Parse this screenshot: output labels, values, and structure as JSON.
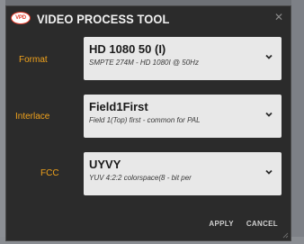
{
  "window": {
    "logo_text": "VPD",
    "title": "VIDEO PROCESS TOOL"
  },
  "rows": [
    {
      "label": "Format",
      "value": "HD 1080 50 (I)",
      "description": "SMPTE 274M - HD 1080I @ 50Hz"
    },
    {
      "label": "Interlace",
      "value": "Field1First",
      "description": "Field 1(Top) first - common for PAL"
    },
    {
      "label": "FCC",
      "value": "UYVY",
      "description": "YUV 4:2:2 colorspace(8 - bit per"
    }
  ],
  "actions": {
    "apply_label": "APPLY",
    "cancel_label": "CANCEL"
  },
  "colors": {
    "accent": "#f0a21c",
    "dialog_bg": "#2b2b2b",
    "select_bg": "#e8e8e8",
    "logo": "#e23a2a"
  }
}
